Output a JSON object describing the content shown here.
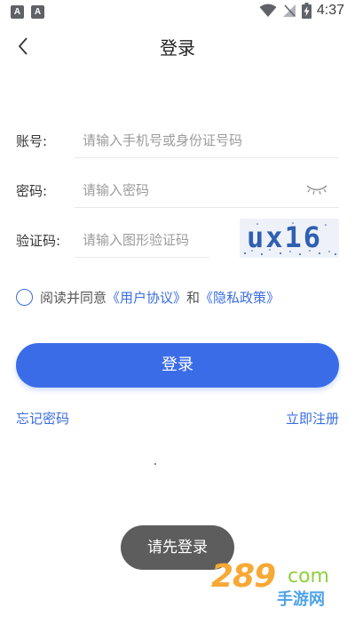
{
  "status_bar": {
    "time": "4:37",
    "app_icons": [
      "A",
      "A"
    ]
  },
  "header": {
    "title": "登录"
  },
  "form": {
    "account": {
      "label": "账号:",
      "placeholder": "请输入手机号或身份证号码"
    },
    "password": {
      "label": "密码:",
      "placeholder": "请输入密码"
    },
    "captcha": {
      "label": "验证码:",
      "placeholder": "请输入图形验证码",
      "image_text": "ux16"
    }
  },
  "agreement": {
    "prefix": "阅读并同意",
    "user_agreement": "《用户协议》",
    "conjunction": "和",
    "privacy_policy": "《隐私政策》"
  },
  "login_button": {
    "label": "登录"
  },
  "links": {
    "forgot_password": "忘记密码",
    "register": "立即注册"
  },
  "toast": {
    "message": "请先登录"
  },
  "watermark": {
    "number": "289",
    "domain": "com",
    "cn_text": "手游网"
  },
  "colors": {
    "accent": "#3b6ce8",
    "link": "#3a6de0",
    "toast_bg": "#5d5d5d"
  }
}
